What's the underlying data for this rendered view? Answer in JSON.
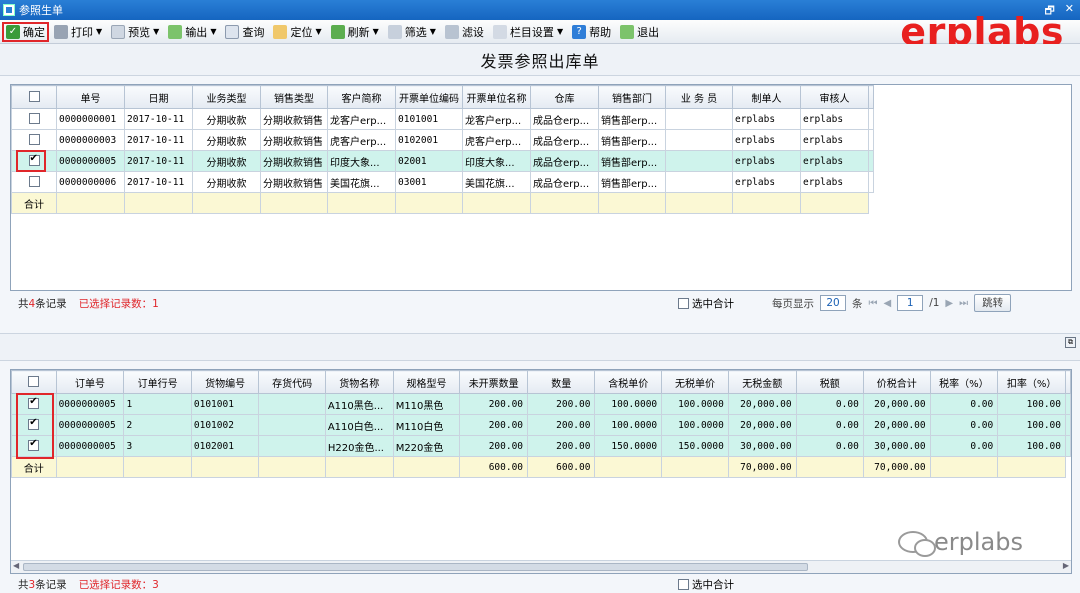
{
  "window": {
    "title": "参照生单"
  },
  "toolbar": {
    "confirm": "确定",
    "print": "打印",
    "preview": "预览",
    "export": "输出",
    "query": "查询",
    "locate": "定位",
    "refresh": "刷新",
    "filter": "筛选",
    "filter2": "滤设",
    "columns": "栏目设置",
    "help": "帮助",
    "exit": "退出"
  },
  "brand": "erplabs",
  "page_title": "发票参照出库单",
  "top_table": {
    "headers": [
      "单号",
      "日期",
      "业务类型",
      "销售类型",
      "客户简称",
      "开票单位编码",
      "开票单位名称",
      "仓库",
      "销售部门",
      "业 务 员",
      "制单人",
      "审核人"
    ],
    "rows": [
      {
        "checked": false,
        "cells": [
          "0000000001",
          "2017-10-11",
          "分期收款",
          "分期收款销售",
          "龙客户erp...",
          "0101001",
          "龙客户erp...",
          "成品仓erp...",
          "销售部erp...",
          "",
          "erplabs",
          "erplabs"
        ]
      },
      {
        "checked": false,
        "cells": [
          "0000000003",
          "2017-10-11",
          "分期收款",
          "分期收款销售",
          "虎客户erp...",
          "0102001",
          "虎客户erp...",
          "成品仓erp...",
          "销售部erp...",
          "",
          "erplabs",
          "erplabs"
        ]
      },
      {
        "checked": true,
        "cells": [
          "0000000005",
          "2017-10-11",
          "分期收款",
          "分期收款销售",
          "印度大象...",
          "02001",
          "印度大象...",
          "成品仓erp...",
          "销售部erp...",
          "",
          "erplabs",
          "erplabs"
        ]
      },
      {
        "checked": false,
        "cells": [
          "0000000006",
          "2017-10-11",
          "分期收款",
          "分期收款销售",
          "美国花旗...",
          "03001",
          "美国花旗...",
          "成品仓erp...",
          "销售部erp...",
          "",
          "erplabs",
          "erplabs"
        ]
      }
    ],
    "total_label": "合计"
  },
  "top_status": {
    "count_prefix": "共",
    "count": "4",
    "count_suffix": "条记录",
    "selected": "已选择记录数：1",
    "select_sum": "选中合计",
    "per_page_label": "每页显示",
    "per_page": "20",
    "per_page_unit": "条",
    "page": "1",
    "page_total": "/1",
    "jump": "跳转"
  },
  "bottom_table": {
    "headers": [
      "订单号",
      "订单行号",
      "货物编号",
      "存货代码",
      "货物名称",
      "规格型号",
      "未开票数量",
      "数量",
      "含税单价",
      "无税单价",
      "无税金额",
      "税额",
      "价税合计",
      "税率（%）",
      "扣率（%）"
    ],
    "rows": [
      {
        "checked": true,
        "cells": [
          "0000000005",
          "1",
          "0101001",
          "",
          "A110黑色...",
          "M110黑色",
          "200.00",
          "200.00",
          "100.0000",
          "100.0000",
          "20,000.00",
          "0.00",
          "20,000.00",
          "0.00",
          "100.00"
        ]
      },
      {
        "checked": true,
        "cells": [
          "0000000005",
          "2",
          "0101002",
          "",
          "A110白色...",
          "M110白色",
          "200.00",
          "200.00",
          "100.0000",
          "100.0000",
          "20,000.00",
          "0.00",
          "20,000.00",
          "0.00",
          "100.00"
        ]
      },
      {
        "checked": true,
        "cells": [
          "0000000005",
          "3",
          "0102001",
          "",
          "H220金色...",
          "M220金色",
          "200.00",
          "200.00",
          "150.0000",
          "150.0000",
          "30,000.00",
          "0.00",
          "30,000.00",
          "0.00",
          "100.00"
        ]
      }
    ],
    "total_label": "合计",
    "totals": [
      "",
      "",
      "",
      "",
      "",
      "",
      "600.00",
      "600.00",
      "",
      "",
      "70,000.00",
      "",
      "70,000.00",
      "",
      ""
    ]
  },
  "bottom_status": {
    "count_prefix": "共",
    "count": "3",
    "count_suffix": "条记录",
    "selected": "已选择记录数：3",
    "select_sum": "选中合计"
  },
  "watermark": "erplabs",
  "colors": {
    "selected_row": "#cff3ec",
    "total_row": "#fbf8d4",
    "highlight_box": "#e0262a",
    "brand": "#e8201f",
    "titlebar": "#1565c0"
  }
}
